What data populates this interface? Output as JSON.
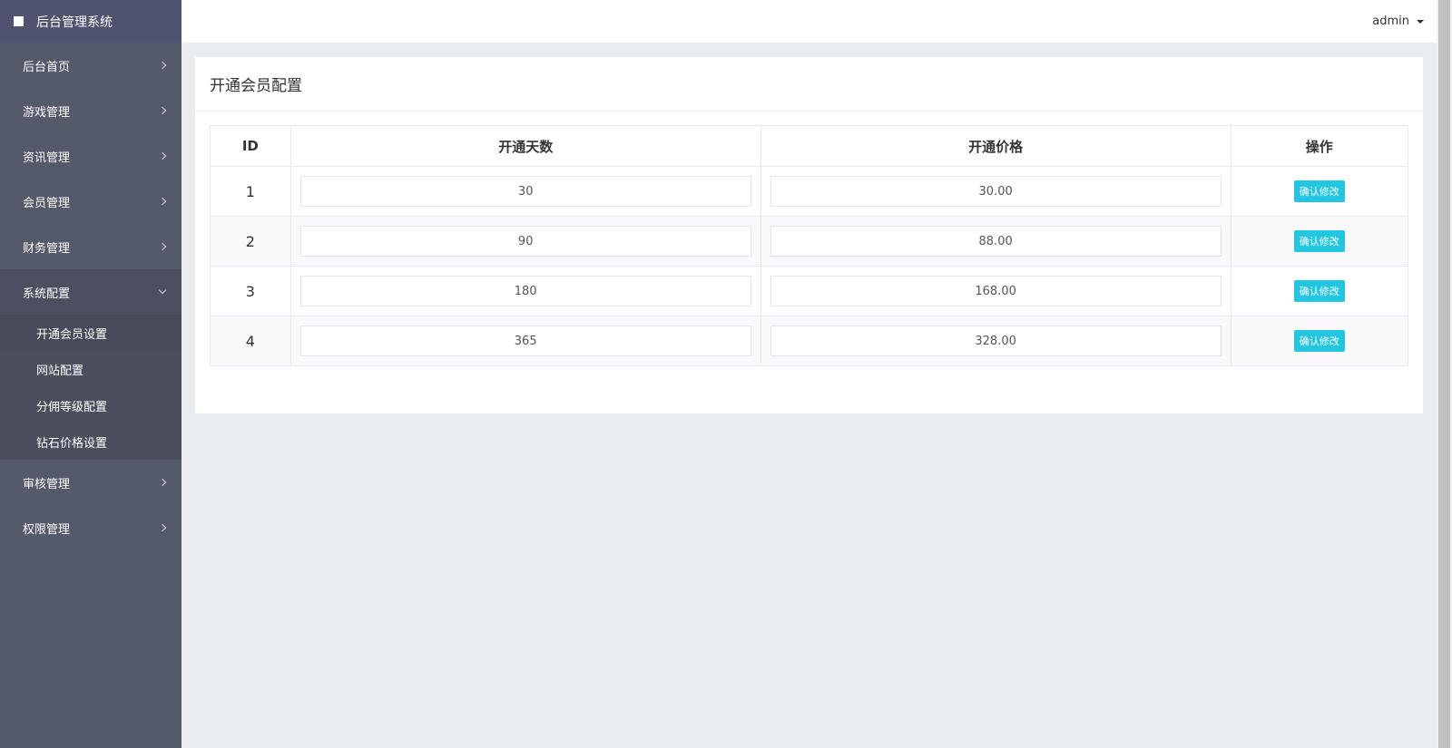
{
  "sidebar": {
    "brand": "后台管理系统",
    "items": [
      {
        "label": "后台首页"
      },
      {
        "label": "游戏管理"
      },
      {
        "label": "资讯管理"
      },
      {
        "label": "会员管理"
      },
      {
        "label": "财务管理"
      },
      {
        "label": "系统配置"
      },
      {
        "label": "审核管理"
      },
      {
        "label": "权限管理"
      }
    ],
    "sub_items": [
      {
        "label": "开通会员设置"
      },
      {
        "label": "网站配置"
      },
      {
        "label": "分佣等级配置"
      },
      {
        "label": "钻石价格设置"
      }
    ]
  },
  "topbar": {
    "user": "admin"
  },
  "panel": {
    "title": "开通会员配置",
    "columns": [
      "ID",
      "开通天数",
      "开通价格",
      "操作"
    ],
    "rows": [
      {
        "id": "1",
        "days": "30",
        "price": "30.00",
        "action": "确认修改"
      },
      {
        "id": "2",
        "days": "90",
        "price": "88.00",
        "action": "确认修改"
      },
      {
        "id": "3",
        "days": "180",
        "price": "168.00",
        "action": "确认修改"
      },
      {
        "id": "4",
        "days": "365",
        "price": "328.00",
        "action": "确认修改"
      }
    ]
  },
  "colors": {
    "sidebar_bg": "#555a6b",
    "brand_bg": "#4f5370",
    "button": "#23c6e0",
    "page_bg": "#e9ecf1"
  }
}
